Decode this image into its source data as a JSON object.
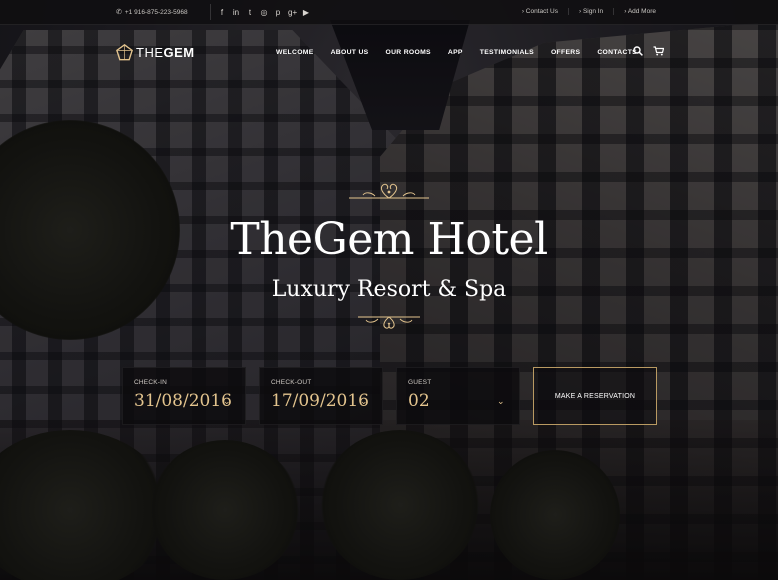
{
  "topbar": {
    "phone": "+1 916-875-223-5968",
    "socials": [
      {
        "name": "facebook-icon",
        "glyph": "f"
      },
      {
        "name": "linkedin-icon",
        "glyph": "in"
      },
      {
        "name": "twitter-icon",
        "glyph": "t"
      },
      {
        "name": "instagram-icon",
        "glyph": "◎"
      },
      {
        "name": "pinterest-icon",
        "glyph": "p"
      },
      {
        "name": "googleplus-icon",
        "glyph": "g+"
      },
      {
        "name": "youtube-icon",
        "glyph": "▶"
      }
    ],
    "links": [
      "Contact Us",
      "Sign In",
      "Add More"
    ]
  },
  "header": {
    "logo_light": "THE",
    "logo_bold": "GEM",
    "nav": [
      "WELCOME",
      "ABOUT US",
      "OUR ROOMS",
      "APP",
      "TESTIMONIALS",
      "OFFERS",
      "CONTACTS"
    ]
  },
  "hero": {
    "title": "TheGem Hotel",
    "subtitle": "Luxury Resort & Spa"
  },
  "booking": {
    "checkin_label": "CHECK-IN",
    "checkin_value": "31/08/2016",
    "checkout_label": "CHECK-OUT",
    "checkout_value": "17/09/2016",
    "guest_label": "GUEST",
    "guest_value": "02",
    "reserve_label": "MAKE A RESERVATION"
  },
  "colors": {
    "accent_gold": "#e3c48e",
    "border_gold": "#b99a62",
    "dark_box": "#0c0b0e"
  }
}
